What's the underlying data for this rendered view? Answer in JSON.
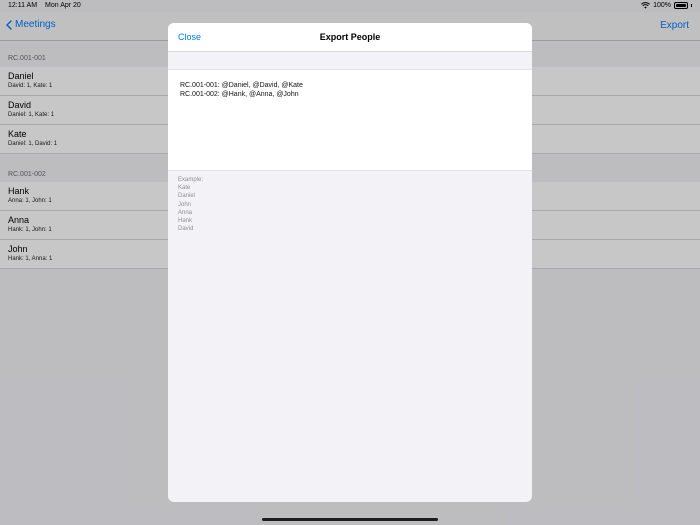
{
  "status_bar": {
    "time": "12:11 AM",
    "date": "Mon Apr 20",
    "battery": "100%"
  },
  "nav": {
    "back_label": "Meetings",
    "title": "",
    "export_label": "Export"
  },
  "sections": [
    {
      "header": "RC.001-001",
      "rows": [
        {
          "name": "Daniel",
          "detail": "David: 1, Kate: 1"
        },
        {
          "name": "David",
          "detail": "Daniel: 1, Kate: 1"
        },
        {
          "name": "Kate",
          "detail": "Daniel: 1, David: 1"
        }
      ]
    },
    {
      "header": "RC.001-002",
      "rows": [
        {
          "name": "Hank",
          "detail": "Anna: 1, John: 1"
        },
        {
          "name": "Anna",
          "detail": "Hank: 1, John: 1"
        },
        {
          "name": "John",
          "detail": "Hank: 1, Anna: 1"
        }
      ]
    }
  ],
  "modal": {
    "close_label": "Close",
    "title": "Export People",
    "text_lines": [
      "RC.001-001: @Daniel, @David, @Kate",
      "RC.001-002: @Hank, @Anna, @John"
    ],
    "example_lines": [
      "Example:",
      "Kate",
      "Daniel",
      "John",
      "Anna",
      "Hank",
      "David"
    ]
  },
  "colors": {
    "accent": "#007aff",
    "background": "#f2f2f7"
  }
}
